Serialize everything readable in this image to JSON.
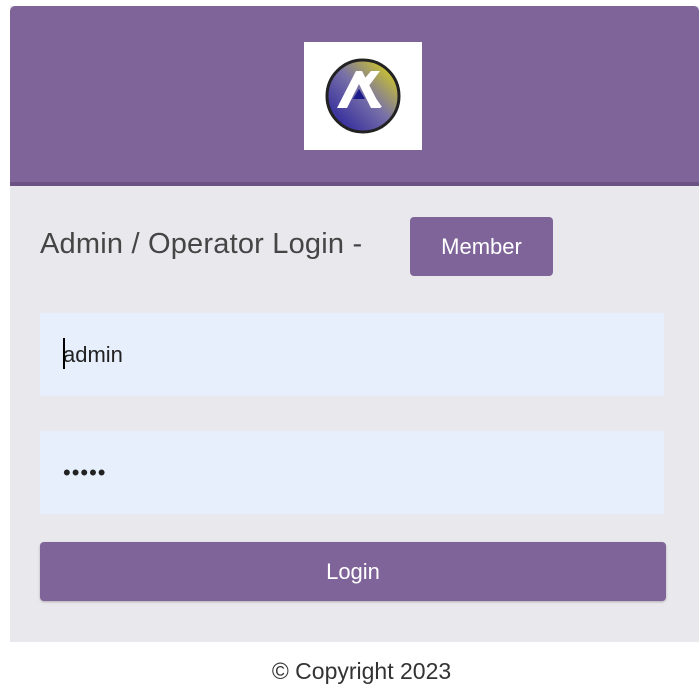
{
  "login": {
    "title": "Admin / Operator Login -",
    "member_button": "Member",
    "username_value": "admin",
    "password_value": "12345",
    "login_button": "Login"
  },
  "footer": {
    "copyright": "© Copyright 2023"
  },
  "logo": {
    "icon": "company-logo-icon"
  },
  "colors": {
    "primary": "#7f6499",
    "field_background": "#e7effd",
    "panel_background": "#e9e8ec"
  }
}
